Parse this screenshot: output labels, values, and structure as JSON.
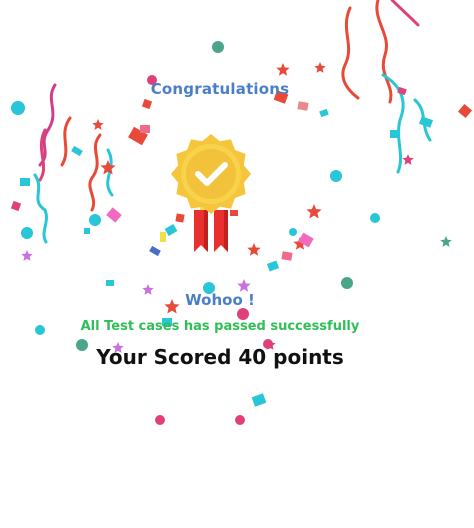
{
  "result": {
    "title": "Congratulations",
    "exclamation": "Wohoo !",
    "message": "All Test cases has passed successfully",
    "score_text": "Your Scored 40 points"
  },
  "colors": {
    "title": "#4a7fc7",
    "success": "#2fbf57",
    "score": "#111111",
    "badge_gold": "#f5c63c",
    "ribbon": "#e8312f"
  },
  "icons": {
    "badge": "award-badge-icon",
    "check": "checkmark-icon"
  }
}
